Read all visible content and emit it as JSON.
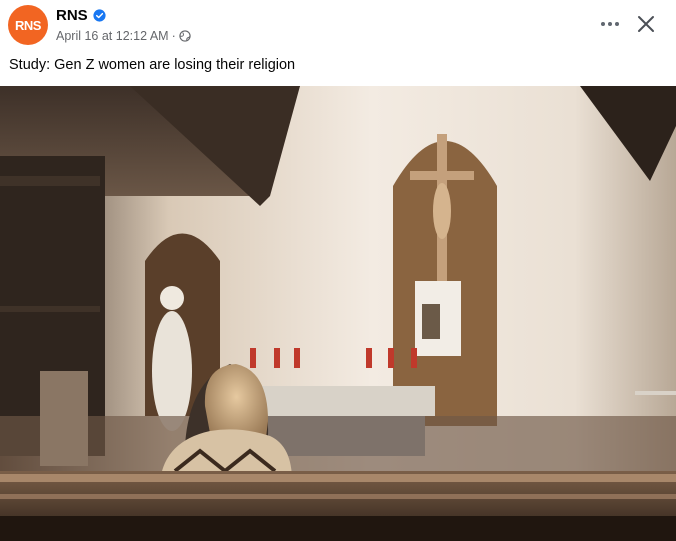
{
  "post": {
    "avatar_text": "RNS",
    "page_name": "RNS",
    "timestamp": "April 16 at 12:12 AM",
    "separator": "·",
    "text": "Study: Gen Z women are losing their religion"
  },
  "icons": {
    "verified": "verified-badge-icon",
    "audience": "globe-icon",
    "more": "more-options-icon",
    "close": "close-icon"
  },
  "colors": {
    "avatar_bg": "#f26522",
    "verified_blue": "#1877f2",
    "meta_gray": "#65676b"
  },
  "photo": {
    "subject": "woman sitting in church pew facing altar with crucifix"
  }
}
